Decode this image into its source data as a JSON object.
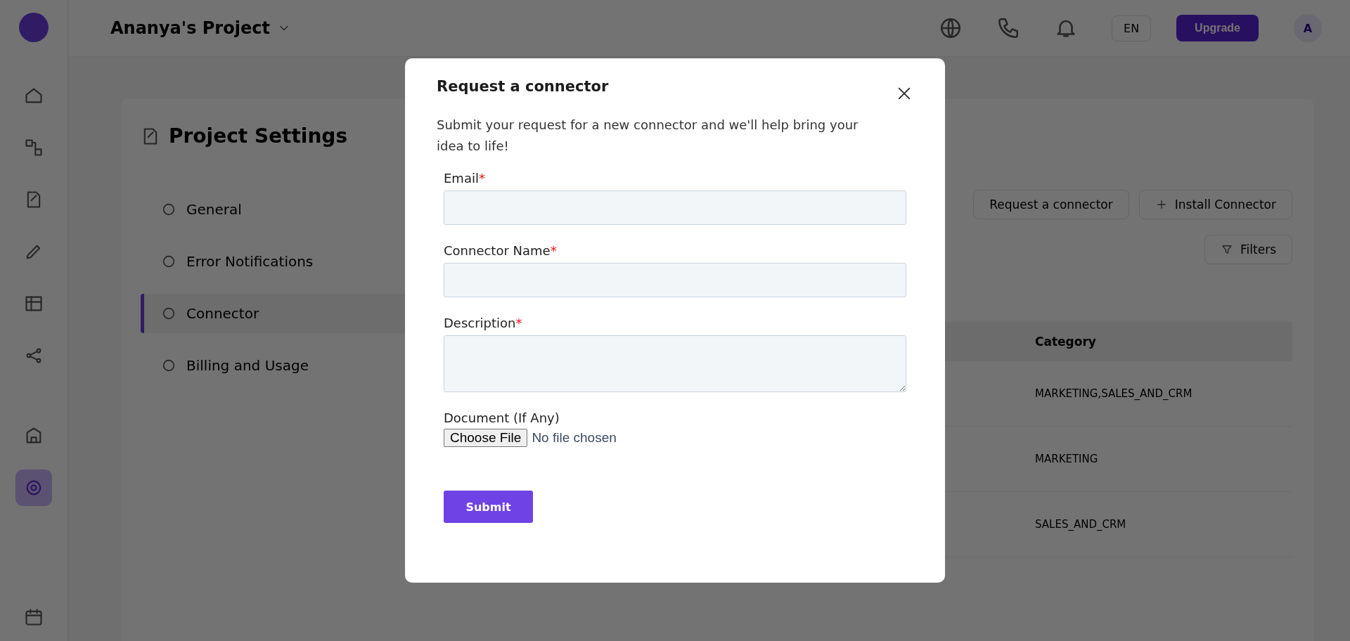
{
  "app_header": {
    "project": "Ananya's Project",
    "language": "EN",
    "upgrade_button": "Upgrade",
    "avatar": "A"
  },
  "sidebar_nav": [
    {
      "selected": false
    },
    {
      "selected": false
    },
    {
      "selected": false
    },
    {
      "selected": false
    },
    {
      "selected": false
    },
    {
      "selected": false
    },
    {
      "selected": false
    },
    {
      "selected": true
    },
    {
      "selected": false
    }
  ],
  "settings": {
    "title": "Project Settings",
    "menu": [
      {
        "label": "General",
        "selected": false
      },
      {
        "label": "Error Notifications",
        "selected": false
      },
      {
        "label": "Connector",
        "selected": true
      },
      {
        "label": "Billing and Usage",
        "selected": false
      }
    ]
  },
  "connectors": {
    "actions": [
      "Request a connector",
      "Install Connector"
    ],
    "filter_button": "Filters",
    "table": {
      "columns": [
        "Category"
      ],
      "rows": [
        {
          "category": "MARKETING,SALES_AND_CRM"
        },
        {
          "category": "MARKETING"
        },
        {
          "category": "SALES_AND_CRM"
        }
      ]
    }
  },
  "dialog": {
    "title": "Request a connector",
    "required_mark": "*",
    "subtitle": "Submit your request for a new connector and we'll help bring your idea to life!",
    "fields": [
      {
        "kind": "text",
        "label": "Email",
        "required": true
      },
      {
        "kind": "text",
        "label": "Connector Name",
        "required": true
      },
      {
        "kind": "textarea",
        "label": "Description",
        "required": true
      },
      {
        "kind": "file",
        "label": "Document (If Any)",
        "required": false,
        "button": "Choose File",
        "status": "No file chosen"
      }
    ],
    "submit": "Submit"
  }
}
